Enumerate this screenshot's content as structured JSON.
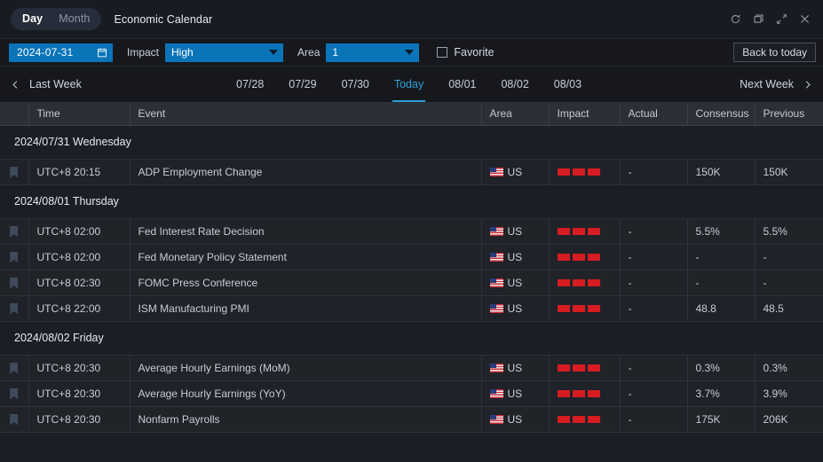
{
  "titlebar": {
    "segments": [
      {
        "label": "Day",
        "active": true
      },
      {
        "label": "Month",
        "active": false
      }
    ],
    "title": "Economic Calendar",
    "window_icons": [
      "refresh-icon",
      "restore-icon",
      "expand-icon",
      "close-icon"
    ]
  },
  "filterbar": {
    "date_value": "2024-07-31",
    "date_icon": "calendar-icon",
    "impact_label": "Impact",
    "impact_value": "High",
    "area_label": "Area",
    "area_value": "1",
    "favorite_label": "Favorite",
    "favorite_checked": false,
    "back_to_today": "Back to today",
    "accent_blue": "#0a74b8"
  },
  "weeknav": {
    "prev_label": "Last Week",
    "next_label": "Next Week",
    "days": [
      {
        "label": "07/28",
        "today": false
      },
      {
        "label": "07/29",
        "today": false
      },
      {
        "label": "07/30",
        "today": false
      },
      {
        "label": "Today",
        "today": true
      },
      {
        "label": "08/01",
        "today": false
      },
      {
        "label": "08/02",
        "today": false
      },
      {
        "label": "08/03",
        "today": false
      }
    ],
    "today_color": "#2f9fd4"
  },
  "table": {
    "columns": [
      "",
      "Time",
      "Event",
      "Area",
      "Impact",
      "Actual",
      "Consensus",
      "Previous"
    ],
    "groups": [
      {
        "title": "2024/07/31 Wednesday",
        "rows": [
          {
            "time": "UTC+8 20:15",
            "event": "ADP Employment Change",
            "area": "US",
            "impact": 3,
            "actual": "-",
            "consensus": "150K",
            "previous": "150K"
          }
        ]
      },
      {
        "title": "2024/08/01 Thursday",
        "rows": [
          {
            "time": "UTC+8 02:00",
            "event": "Fed Interest Rate Decision",
            "area": "US",
            "impact": 3,
            "actual": "-",
            "consensus": "5.5%",
            "previous": "5.5%"
          },
          {
            "time": "UTC+8 02:00",
            "event": "Fed Monetary Policy Statement",
            "area": "US",
            "impact": 3,
            "actual": "-",
            "consensus": "-",
            "previous": "-"
          },
          {
            "time": "UTC+8 02:30",
            "event": "FOMC Press Conference",
            "area": "US",
            "impact": 3,
            "actual": "-",
            "consensus": "-",
            "previous": "-"
          },
          {
            "time": "UTC+8 22:00",
            "event": "ISM Manufacturing PMI",
            "area": "US",
            "impact": 3,
            "actual": "-",
            "consensus": "48.8",
            "previous": "48.5"
          }
        ]
      },
      {
        "title": "2024/08/02 Friday",
        "rows": [
          {
            "time": "UTC+8 20:30",
            "event": "Average Hourly Earnings (MoM)",
            "area": "US",
            "impact": 3,
            "actual": "-",
            "consensus": "0.3%",
            "previous": "0.3%"
          },
          {
            "time": "UTC+8 20:30",
            "event": "Average Hourly Earnings (YoY)",
            "area": "US",
            "impact": 3,
            "actual": "-",
            "consensus": "3.7%",
            "previous": "3.9%"
          },
          {
            "time": "UTC+8 20:30",
            "event": "Nonfarm Payrolls",
            "area": "US",
            "impact": 3,
            "actual": "-",
            "consensus": "175K",
            "previous": "206K"
          }
        ]
      }
    ],
    "impact_bar_color": "#d61c20"
  }
}
